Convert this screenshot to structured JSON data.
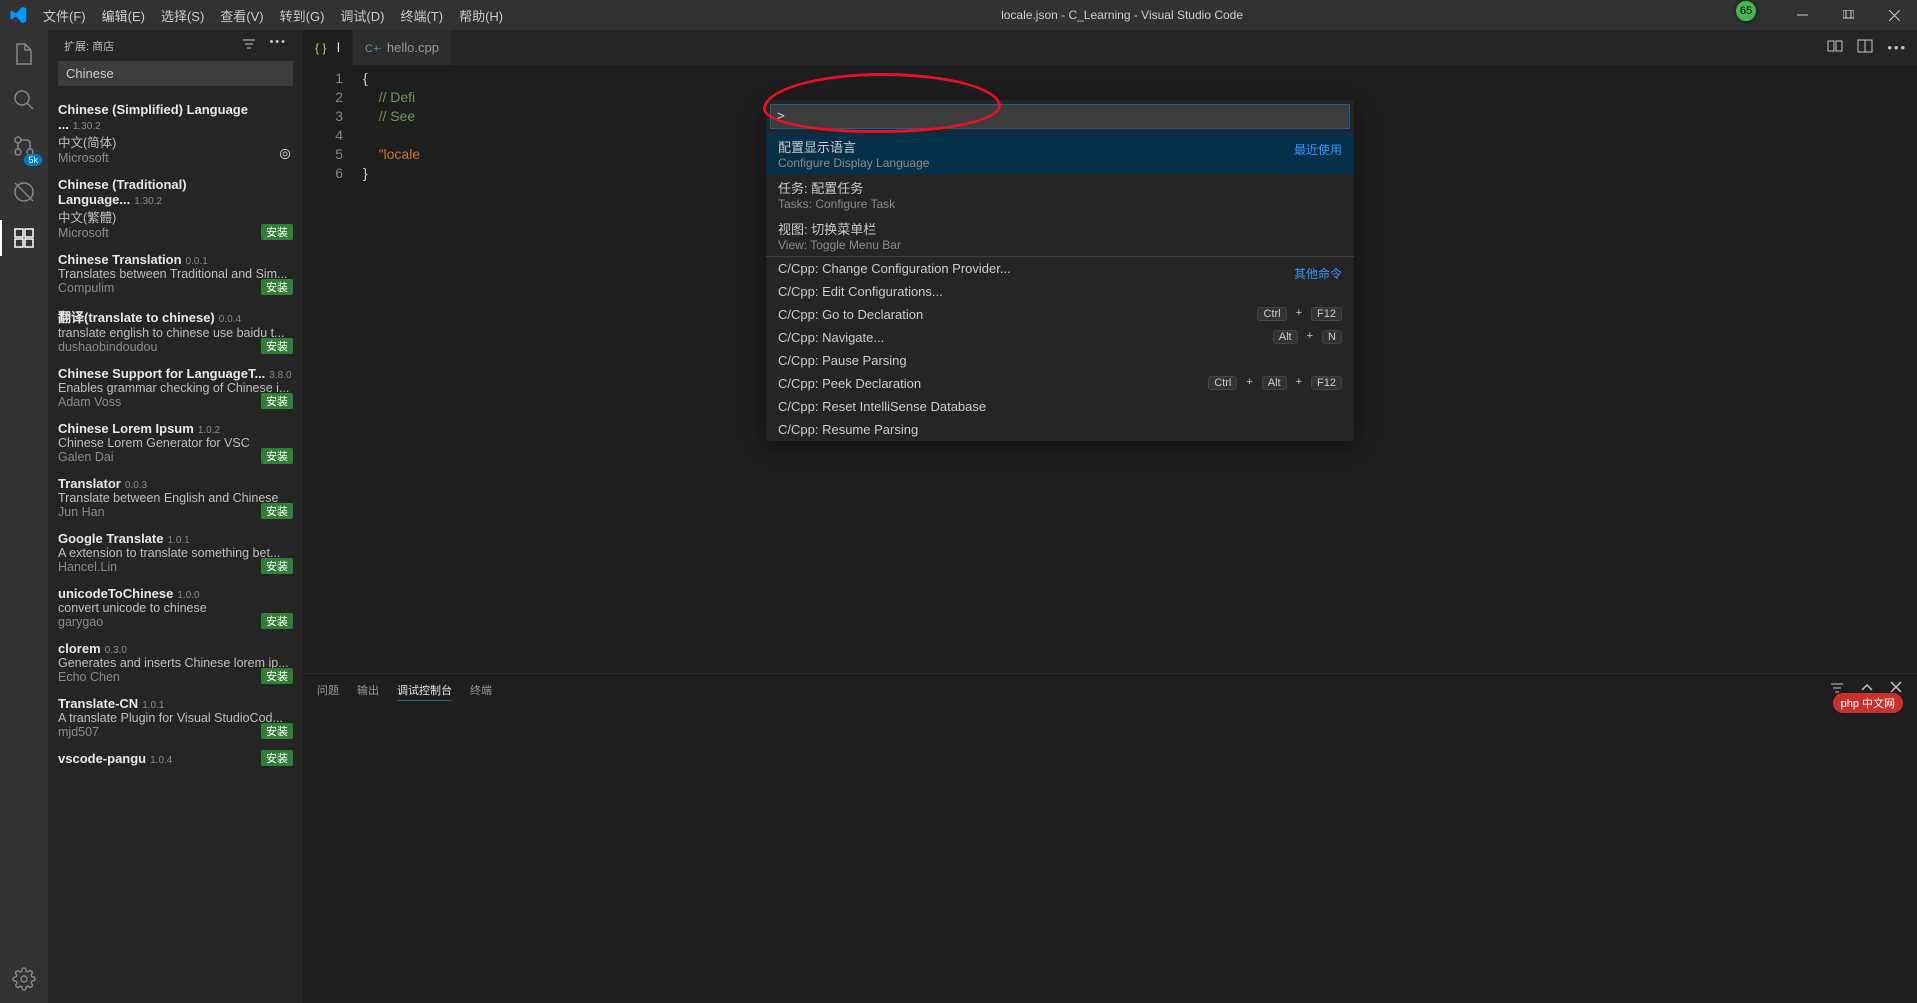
{
  "window": {
    "title": "locale.json - C_Learning - Visual Studio Code",
    "badge": "65"
  },
  "menu": [
    "文件(F)",
    "编辑(E)",
    "选择(S)",
    "查看(V)",
    "转到(G)",
    "调试(D)",
    "终端(T)",
    "帮助(H)"
  ],
  "activitybar": {
    "source_badge": "5k"
  },
  "sidebar": {
    "title": "扩展: 商店",
    "search_value": "Chinese",
    "install_label": "安装",
    "extensions": [
      {
        "name": "Chinese (Simplified) Language ...",
        "ver": "1.30.2",
        "desc": "中文(简体)",
        "author": "Microsoft",
        "installed": true
      },
      {
        "name": "Chinese (Traditional) Language...",
        "ver": "1.30.2",
        "desc": "中文(繁體)",
        "author": "Microsoft",
        "installed": false
      },
      {
        "name": "Chinese Translation",
        "ver": "0.0.1",
        "desc": "Translates between Traditional and Sim...",
        "author": "Compulim",
        "installed": false
      },
      {
        "name": "翻译(translate to chinese)",
        "ver": "0.0.4",
        "desc": "translate english to chinese use baidu t...",
        "author": "dushaobindoudou",
        "installed": false
      },
      {
        "name": "Chinese Support for LanguageT...",
        "ver": "3.8.0",
        "desc": "Enables grammar checking of Chinese i...",
        "author": "Adam Voss",
        "installed": false
      },
      {
        "name": "Chinese Lorem Ipsum",
        "ver": "1.0.2",
        "desc": "Chinese Lorem Generator for VSC",
        "author": "Galen Dai",
        "installed": false
      },
      {
        "name": "Translator",
        "ver": "0.0.3",
        "desc": "Translate between English and Chinese",
        "author": "Jun Han",
        "installed": false
      },
      {
        "name": "Google Translate",
        "ver": "1.0.1",
        "desc": "A extension to translate something bet...",
        "author": "Hancel.Lin",
        "installed": false
      },
      {
        "name": "unicodeToChinese",
        "ver": "1.0.0",
        "desc": "convert unicode to chinese",
        "author": "garygao",
        "installed": false
      },
      {
        "name": "clorem",
        "ver": "0.3.0",
        "desc": "Generates and inserts Chinese lorem ip...",
        "author": "Echo Chen",
        "installed": false
      },
      {
        "name": "Translate-CN",
        "ver": "1.0.1",
        "desc": "A translate Plugin for Visual StudioCod...",
        "author": "mjd507",
        "installed": false
      },
      {
        "name": "vscode-pangu",
        "ver": "1.0.4",
        "desc": "",
        "author": "",
        "installed": false
      }
    ]
  },
  "tabs": [
    {
      "label": "hello.cpp",
      "icon": "cpp",
      "active": false
    },
    {
      "label": "l",
      "icon": "json",
      "active": true
    }
  ],
  "code": {
    "lines": [
      {
        "n": "1",
        "html": "<span class='tok-brace'>{</span>"
      },
      {
        "n": "2",
        "html": "    <span class='tok-comment'>// Defi</span>"
      },
      {
        "n": "3",
        "html": "    <span class='tok-comment'>// See </span>                                                                                             <span class='tok-comment'>es.</span>"
      },
      {
        "n": "4",
        "html": ""
      },
      {
        "n": "5",
        "html": "    <span class='tok-string'>\"locale</span>"
      },
      {
        "n": "6",
        "html": "<span class='tok-brace'>}</span>"
      }
    ]
  },
  "palette": {
    "input": ">",
    "recent_label": "最近使用",
    "other_label": "其他命令",
    "items": [
      {
        "main": "配置显示语言",
        "sub": "Configure Display Language",
        "right": "recent",
        "hl": true
      },
      {
        "main": "任务: 配置任务",
        "sub": "Tasks: Configure Task"
      },
      {
        "main": "视图: 切换菜单栏",
        "sub": "View: Toggle Menu Bar"
      },
      {
        "main": "C/Cpp: Change Configuration Provider...",
        "right": "other",
        "sep": true
      },
      {
        "main": "C/Cpp: Edit Configurations..."
      },
      {
        "main": "C/Cpp: Go to Declaration",
        "keys": [
          "Ctrl",
          "+",
          "F12"
        ]
      },
      {
        "main": "C/Cpp: Navigate...",
        "keys": [
          "Alt",
          "+",
          "N"
        ]
      },
      {
        "main": "C/Cpp: Pause Parsing"
      },
      {
        "main": "C/Cpp: Peek Declaration",
        "keys": [
          "Ctrl",
          "+",
          "Alt",
          "+",
          "F12"
        ]
      },
      {
        "main": "C/Cpp: Reset IntelliSense Database"
      },
      {
        "main": "C/Cpp: Resume Parsing"
      }
    ]
  },
  "panel": {
    "tabs": [
      "问题",
      "输出",
      "调试控制台",
      "终端"
    ],
    "active": 2
  },
  "watermark": "php 中文网"
}
